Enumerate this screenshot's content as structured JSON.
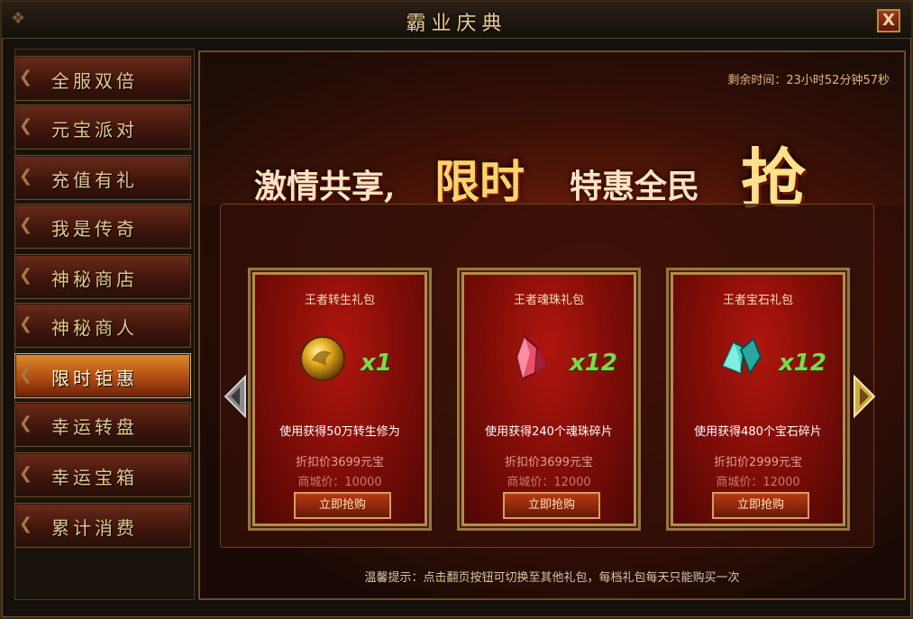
{
  "window": {
    "title": "霸业庆典",
    "close_label": "X"
  },
  "sidebar": {
    "items": [
      {
        "label": "全服双倍",
        "active": false
      },
      {
        "label": "元宝派对",
        "active": false
      },
      {
        "label": "充值有礼",
        "active": false
      },
      {
        "label": "我是传奇",
        "active": false
      },
      {
        "label": "神秘商店",
        "active": false
      },
      {
        "label": "神秘商人",
        "active": false
      },
      {
        "label": "限时钜惠",
        "active": true
      },
      {
        "label": "幸运转盘",
        "active": false
      },
      {
        "label": "幸运宝箱",
        "active": false
      },
      {
        "label": "累计消费",
        "active": false
      }
    ]
  },
  "main": {
    "timer": "剩余时间：23小时52分钟57秒",
    "banner": {
      "part1": "激情共享,",
      "part2": "限时",
      "part3": "特惠全民",
      "part4": "抢"
    },
    "cards": [
      {
        "name": "王者转生礼包",
        "icon": "gold-orb-icon",
        "qty": "x1",
        "desc": "使用获得50万转生修为",
        "discount": "折扣价3699元宝",
        "mall": "商城价：10000",
        "button": "立即抢购"
      },
      {
        "name": "王者魂珠礼包",
        "icon": "red-crystal-icon",
        "qty": "x12",
        "desc": "使用获得240个魂珠碎片",
        "discount": "折扣价3699元宝",
        "mall": "商城价：12000",
        "button": "立即抢购"
      },
      {
        "name": "王者宝石礼包",
        "icon": "cyan-crystal-icon",
        "qty": "x12",
        "desc": "使用获得480个宝石碎片",
        "discount": "折扣价2999元宝",
        "mall": "商城价：12000",
        "button": "立即抢购"
      }
    ],
    "tip": "温馨提示：点击翻页按钮可切换至其他礼包，每档礼包每天只能购买一次"
  },
  "colors": {
    "accent_gold": "#e0b062",
    "card_red": "#9a0f09",
    "qty_green": "#7cd94a"
  }
}
